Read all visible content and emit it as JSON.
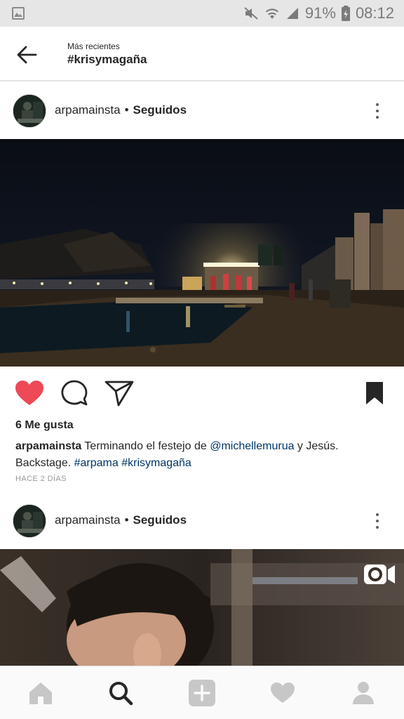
{
  "status_bar": {
    "battery": "91%",
    "time": "08:12"
  },
  "header": {
    "subtitle": "Más recientes",
    "title": "#krisymagaña"
  },
  "posts": [
    {
      "username": "arpamainsta",
      "follow_status": "Seguidos",
      "likes": "6 Me gusta",
      "caption_user": "arpamainsta",
      "caption_text_1": " Terminando el festejo de ",
      "caption_mention": "@michellemurua",
      "caption_text_2": " y Jesús. Backstage. ",
      "caption_tag_1": "#arpama",
      "caption_tag_2": "#krisymagaña",
      "time": "HACE 2 DÍAS"
    },
    {
      "username": "arpamainsta",
      "follow_status": "Seguidos"
    }
  ],
  "colors": {
    "like_red": "#ed4956",
    "link_blue": "#003569",
    "icon_gray": "#c7c7c7",
    "active_icon": "#262626"
  },
  "icons": {
    "back": "arrow-left-icon",
    "like": "heart-filled-icon",
    "comment": "comment-bubble-icon",
    "share": "paper-plane-icon",
    "save": "bookmark-filled-icon",
    "more": "vertical-dots-icon",
    "video": "video-camera-icon",
    "nav": [
      "home-icon",
      "search-icon",
      "add-icon",
      "activity-heart-icon",
      "profile-icon"
    ]
  }
}
